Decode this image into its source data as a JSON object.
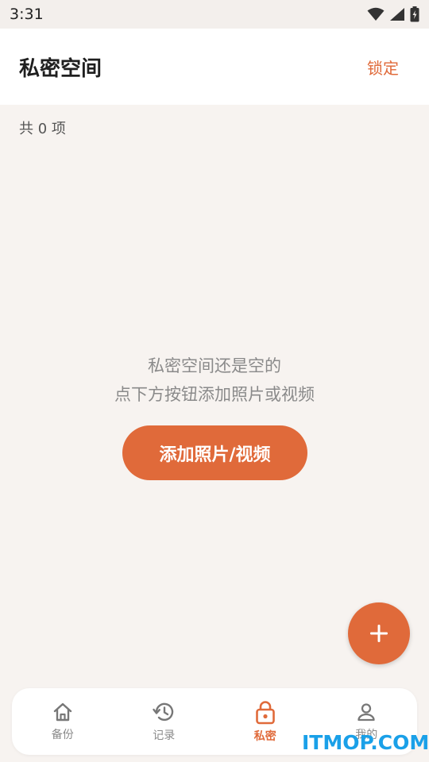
{
  "status_bar": {
    "time": "3:31",
    "icons": [
      "wifi-icon",
      "signal-icon",
      "battery-icon"
    ]
  },
  "header": {
    "title": "私密空间",
    "lock_label": "锁定"
  },
  "content": {
    "count_text": "共 0 项",
    "empty_line1": "私密空间还是空的",
    "empty_line2": "点下方按钮添加照片或视频",
    "add_button_label": "添加照片/视频"
  },
  "fab": {
    "icon": "plus-icon"
  },
  "bottom_nav": {
    "items": [
      {
        "label": "备份",
        "icon": "home-icon",
        "active": false
      },
      {
        "label": "记录",
        "icon": "history-icon",
        "active": false
      },
      {
        "label": "私密",
        "icon": "lock-icon",
        "active": true
      },
      {
        "label": "我的",
        "icon": "user-icon",
        "active": false
      }
    ]
  },
  "watermark": "ITMOP.COM",
  "colors": {
    "accent": "#e06a3a",
    "background": "#f7f3f0",
    "watermark": "#1aa0e8"
  }
}
